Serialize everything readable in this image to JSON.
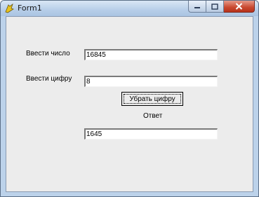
{
  "window": {
    "title": "Form1"
  },
  "form": {
    "number_label": "Ввести число",
    "number_value": "16845",
    "digit_label": "Ввести цифру",
    "digit_value": "8",
    "remove_button_label": "Убрать цифру",
    "answer_label": "Ответ",
    "answer_value": "1645"
  },
  "colors": {
    "close_button": "#c9482f",
    "titlebar": "#bcd2ea",
    "client_background": "#ececec"
  }
}
